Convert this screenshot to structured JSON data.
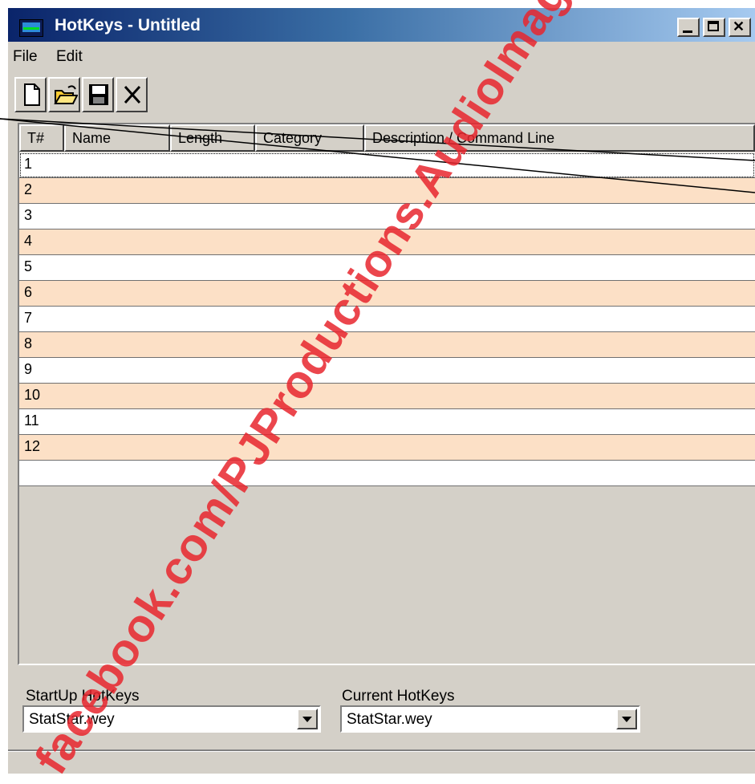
{
  "window": {
    "title": "HotKeys - Untitled",
    "icon": "app-monitor-icon"
  },
  "menu": [
    {
      "label": "File"
    },
    {
      "label": "Edit"
    }
  ],
  "toolbar": [
    {
      "name": "new-icon"
    },
    {
      "name": "open-folder-icon"
    },
    {
      "name": "save-disk-icon"
    },
    {
      "name": "delete-x-icon"
    }
  ],
  "table": {
    "columns": [
      "T#",
      "Name",
      "Length",
      "Category",
      "Description / Command Line"
    ],
    "rows": [
      "1",
      "2",
      "3",
      "4",
      "5",
      "6",
      "7",
      "8",
      "9",
      "10",
      "11",
      "12",
      ""
    ],
    "selected_row": "1"
  },
  "startup": {
    "label": "StartUp HotKeys",
    "value": "StatStar.wey"
  },
  "current": {
    "label": "Current HotKeys",
    "value": "StatStar.wey"
  },
  "watermark": "facebook.com/PJProductions.AudioImag",
  "colors": {
    "row_alt": "#fce0c6",
    "titlebar": "#0a246a",
    "watermark": "#e8262e"
  }
}
